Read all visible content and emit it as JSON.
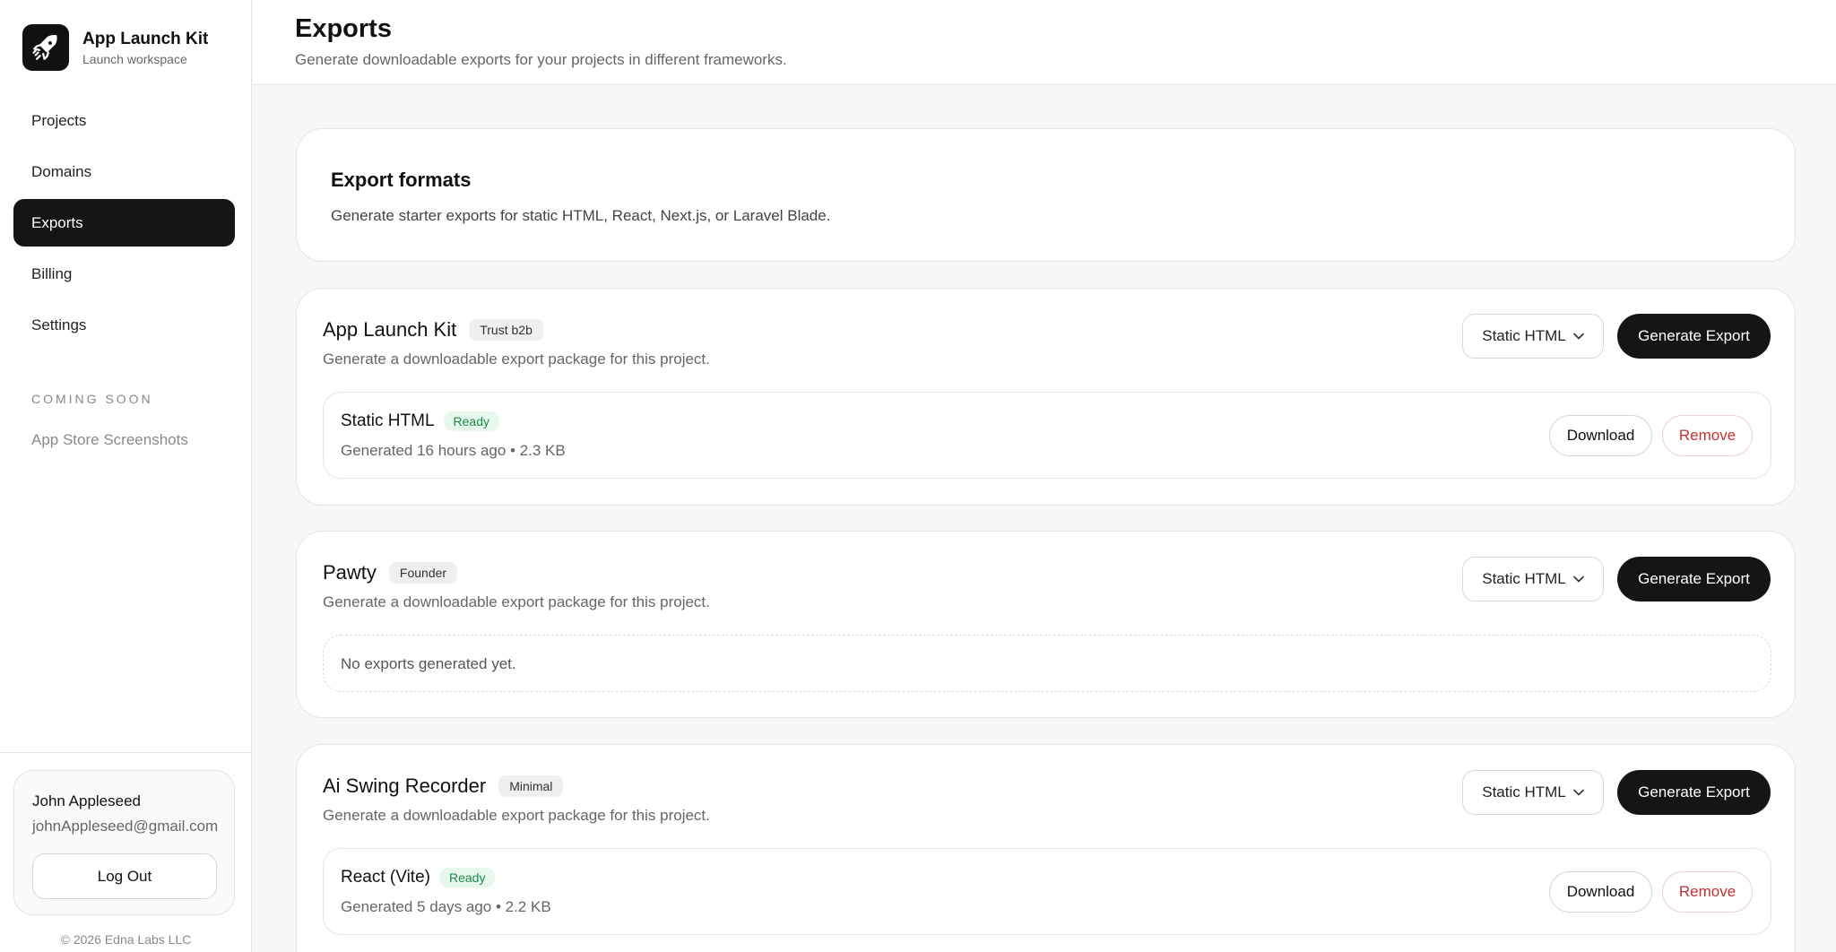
{
  "brand": {
    "name": "App Launch Kit",
    "subtitle": "Launch workspace",
    "icon": "rocket-icon"
  },
  "nav": {
    "items": [
      {
        "label": "Projects",
        "active": false
      },
      {
        "label": "Domains",
        "active": false
      },
      {
        "label": "Exports",
        "active": true
      },
      {
        "label": "Billing",
        "active": false
      },
      {
        "label": "Settings",
        "active": false
      }
    ],
    "coming_soon_label": "COMING SOON",
    "coming_soon_items": [
      "App Store Screenshots"
    ]
  },
  "user": {
    "name": "John Appleseed",
    "email": "johnAppleseed@gmail.com",
    "logout_label": "Log Out"
  },
  "footer": {
    "copyright": "© 2026 Edna Labs LLC"
  },
  "header": {
    "title": "Exports",
    "subtitle": "Generate downloadable exports for your projects in different frameworks."
  },
  "formats_card": {
    "title": "Export formats",
    "description": "Generate starter exports for static HTML, React, Next.js, or Laravel Blade."
  },
  "projects": [
    {
      "name": "App Launch Kit",
      "tag": "Trust b2b",
      "description": "Generate a downloadable export package for this project.",
      "selected_format": "Static HTML",
      "generate_label": "Generate Export",
      "exports": [
        {
          "name": "Static HTML",
          "status": "Ready",
          "meta": "Generated 16 hours ago • 2.3 KB",
          "download_label": "Download",
          "remove_label": "Remove"
        }
      ]
    },
    {
      "name": "Pawty",
      "tag": "Founder",
      "description": "Generate a downloadable export package for this project.",
      "selected_format": "Static HTML",
      "generate_label": "Generate Export",
      "empty_message": "No exports generated yet."
    },
    {
      "name": "Ai Swing Recorder",
      "tag": "Minimal",
      "description": "Generate a downloadable export package for this project.",
      "selected_format": "Static HTML",
      "generate_label": "Generate Export",
      "exports": [
        {
          "name": "React (Vite)",
          "status": "Ready",
          "meta": "Generated 5 days ago • 2.2 KB",
          "download_label": "Download",
          "remove_label": "Remove"
        }
      ]
    }
  ],
  "colors": {
    "accent": "#151515",
    "ready": "#1f8a4c",
    "danger": "#c43030"
  }
}
